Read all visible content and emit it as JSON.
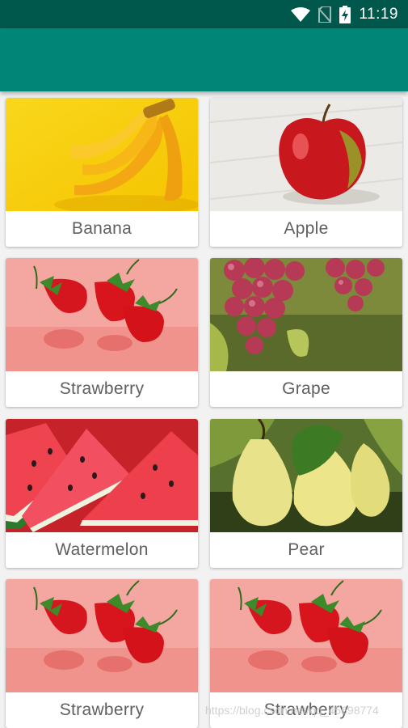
{
  "status_bar": {
    "time": "11:19",
    "icons": [
      "wifi-icon",
      "no-sim-icon",
      "battery-charging-icon"
    ]
  },
  "app_bar": {
    "title": ""
  },
  "colors": {
    "status_bar": "#00574b",
    "app_bar": "#008577",
    "background": "#f2f2f2",
    "label_text": "#5f5f5f"
  },
  "fruits": [
    {
      "name": "Banana",
      "image": "banana-image"
    },
    {
      "name": "Apple",
      "image": "apple-image"
    },
    {
      "name": "Strawberry",
      "image": "strawberry-image"
    },
    {
      "name": "Grape",
      "image": "grape-image"
    },
    {
      "name": "Watermelon",
      "image": "watermelon-image"
    },
    {
      "name": "Pear",
      "image": "pear-image"
    },
    {
      "name": "Strawberry",
      "image": "strawberry-image"
    },
    {
      "name": "Strawberry",
      "image": "strawberry-image"
    }
  ],
  "watermark": "https://blog.csdn.net/qq_45698774"
}
